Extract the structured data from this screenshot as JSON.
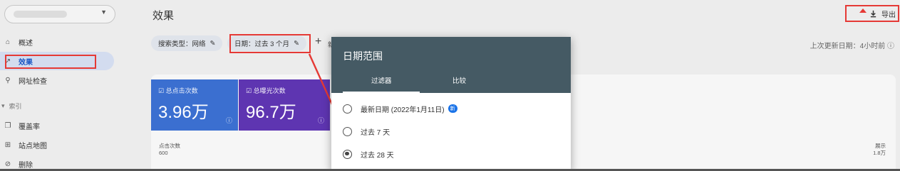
{
  "sidebar": {
    "property": {
      "value": ""
    },
    "items": [
      {
        "label": "概述",
        "icon": "home-icon"
      },
      {
        "label": "效果",
        "icon": "trending-up-icon"
      },
      {
        "label": "网址检查",
        "icon": "search-icon"
      }
    ],
    "index_section": {
      "label": "索引",
      "icon": "chevron-down-icon"
    },
    "index_items": [
      {
        "label": "覆盖率",
        "icon": "copy-icon"
      },
      {
        "label": "站点地图",
        "icon": "sitemap-icon"
      },
      {
        "label": "删除",
        "icon": "eye-off-icon"
      }
    ]
  },
  "header": {
    "title": "效果",
    "export_label": "导出",
    "export_icon": "download-icon"
  },
  "filters": {
    "search_type": "搜索类型：网络",
    "date": "日期：过去 3 个月",
    "add_next": "新",
    "updated": "上次更新日期：4小时前"
  },
  "metrics": [
    {
      "label": "总点击次数",
      "value": "3.96万",
      "color": "#3b6fd0"
    },
    {
      "label": "总曝光次数",
      "value": "96.7万",
      "color": "#5e35b1"
    }
  ],
  "chart": {
    "left_label": "点击次数",
    "left_top": "600",
    "right_label": "展示",
    "right_top": "1.8万"
  },
  "dialog": {
    "title": "日期范围",
    "tabs": [
      "过滤器",
      "比较"
    ],
    "options": [
      {
        "label": "最新日期 (2022年1月11日)",
        "badge": "新",
        "selected": false
      },
      {
        "label": "过去 7 天",
        "selected": false
      },
      {
        "label": "过去 28 天",
        "selected": true
      }
    ]
  },
  "colors": {
    "annotation": "#e53935",
    "dialog_header": "#455a64",
    "accent": "#1a73e8"
  }
}
